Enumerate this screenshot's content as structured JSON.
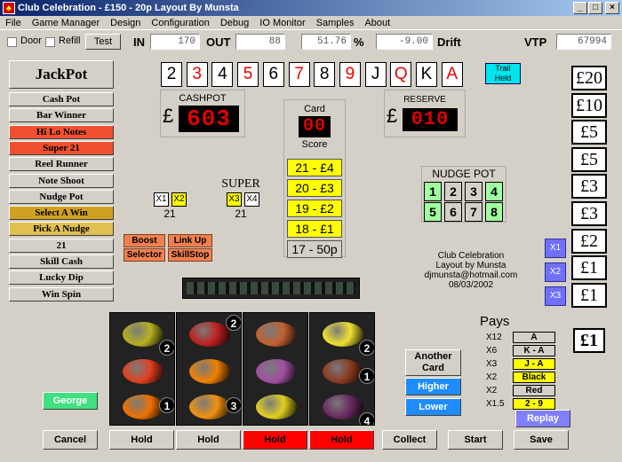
{
  "window": {
    "title": "Club Celebration - £150 - 20p  Layout By Munsta",
    "min": "_",
    "max": "□",
    "close": "×"
  },
  "menu": [
    "File",
    "Game Manager",
    "Design",
    "Configuration",
    "Debug",
    "IO Monitor",
    "Samples",
    "About"
  ],
  "toolbar": {
    "door_label": "Door",
    "refill_label": "Refill",
    "test_label": "Test",
    "in_label": "IN",
    "in_value": "170",
    "out_label": "OUT",
    "out_value": "88",
    "pct_value": "51.76",
    "pct_label": "%",
    "drift_value": "-9.00",
    "drift_label": "Drift",
    "vtp_label": "VTP",
    "vtp_value": "67994"
  },
  "jackpot": {
    "title": "JackPot",
    "items": [
      {
        "label": "Cash Pot",
        "color": "#d4d0c8"
      },
      {
        "label": "Bar Winner",
        "color": "#d4d0c8"
      },
      {
        "label": "Hi Lo Notes",
        "color": "#f05030"
      },
      {
        "label": "Super 21",
        "color": "#f05030"
      },
      {
        "label": "Reel Runner",
        "color": "#d4d0c8"
      },
      {
        "label": "Note Shoot",
        "color": "#d4d0c8"
      },
      {
        "label": "Nudge Pot",
        "color": "#d4d0c8"
      },
      {
        "label": "Select A Win",
        "color": "#d0a020"
      },
      {
        "label": "Pick A Nudge",
        "color": "#e0c050"
      },
      {
        "label": "21",
        "color": "#d4d0c8"
      },
      {
        "label": "Skill Cash",
        "color": "#d4d0c8"
      },
      {
        "label": "Lucky Dip",
        "color": "#d4d0c8"
      },
      {
        "label": "Win Spin",
        "color": "#d4d0c8"
      }
    ]
  },
  "cards": [
    {
      "v": "2",
      "red": false
    },
    {
      "v": "3",
      "red": true
    },
    {
      "v": "4",
      "red": false
    },
    {
      "v": "5",
      "red": true
    },
    {
      "v": "6",
      "red": false
    },
    {
      "v": "7",
      "red": true
    },
    {
      "v": "8",
      "red": false
    },
    {
      "v": "9",
      "red": true
    },
    {
      "v": "J",
      "red": false
    },
    {
      "v": "Q",
      "red": true
    },
    {
      "v": "K",
      "red": false
    },
    {
      "v": "A",
      "red": true
    }
  ],
  "trail": {
    "line1": "Trail",
    "line2": "Held"
  },
  "cashpot": {
    "label": "CASHPOT",
    "currency": "£",
    "value": "603"
  },
  "reserve": {
    "label": "RESERVE",
    "currency": "£",
    "value": "010"
  },
  "card_score": {
    "card_label": "Card",
    "card_value": "00",
    "score_label": "Score"
  },
  "ladder": [
    "21 - £4",
    "20 - £3",
    "19 - £2",
    "18 - £1",
    "17 - 50p"
  ],
  "nudge_pot": {
    "label": "NUDGE POT",
    "row1": [
      "1",
      "2",
      "3",
      "4"
    ],
    "row2": [
      "5",
      "6",
      "7",
      "8"
    ]
  },
  "multipliers_left": {
    "x1": "X1",
    "x2": "X2",
    "value": "21"
  },
  "super": {
    "label": "SUPER",
    "x3": "X3",
    "x4": "X4",
    "value": "21"
  },
  "features": {
    "boost": "Boost",
    "link_up": "Link Up",
    "selector": "Selector",
    "skillstop": "SkillStop"
  },
  "info": {
    "line1": "Club Celebration",
    "line2": "Layout by Munsta",
    "line3": "djmunsta@hotmail.com",
    "line4": "08/03/2002"
  },
  "coins": [
    "£20",
    "£10",
    "£5",
    "£5",
    "£3",
    "£3",
    "£2",
    "£1",
    "£1"
  ],
  "side_mult": [
    "X1",
    "X2",
    "X3"
  ],
  "pays": {
    "title": "Pays",
    "rows": [
      {
        "mult": "X12",
        "label": "A",
        "color": "#d4d0c8"
      },
      {
        "mult": "X6",
        "label": "K - A",
        "color": "#d4d0c8"
      },
      {
        "mult": "X3",
        "label": "J - A",
        "color": "#ffff00"
      },
      {
        "mult": "X2",
        "label": "Black",
        "color": "#ffff00"
      },
      {
        "mult": "X2",
        "label": "Red",
        "color": "#d4d0c8"
      },
      {
        "mult": "X1.5",
        "label": "2 - 9",
        "color": "#ffff00"
      }
    ]
  },
  "stake": "£1",
  "hilo": {
    "another_line1": "Another",
    "another_line2": "Card",
    "higher": "Higher",
    "lower": "Lower"
  },
  "replay": "Replay",
  "george": "George",
  "reels": [
    {
      "badges": [
        "2",
        "1"
      ]
    },
    {
      "badges": [
        "2",
        "3"
      ]
    },
    {
      "badges": [
        ""
      ]
    },
    {
      "badges": [
        "2",
        "1",
        "4"
      ]
    }
  ],
  "bottom": {
    "cancel": "Cancel",
    "hold1": "Hold",
    "hold2": "Hold",
    "hold3": "Hold",
    "hold4": "Hold",
    "collect": "Collect",
    "start": "Start",
    "save": "Save"
  }
}
